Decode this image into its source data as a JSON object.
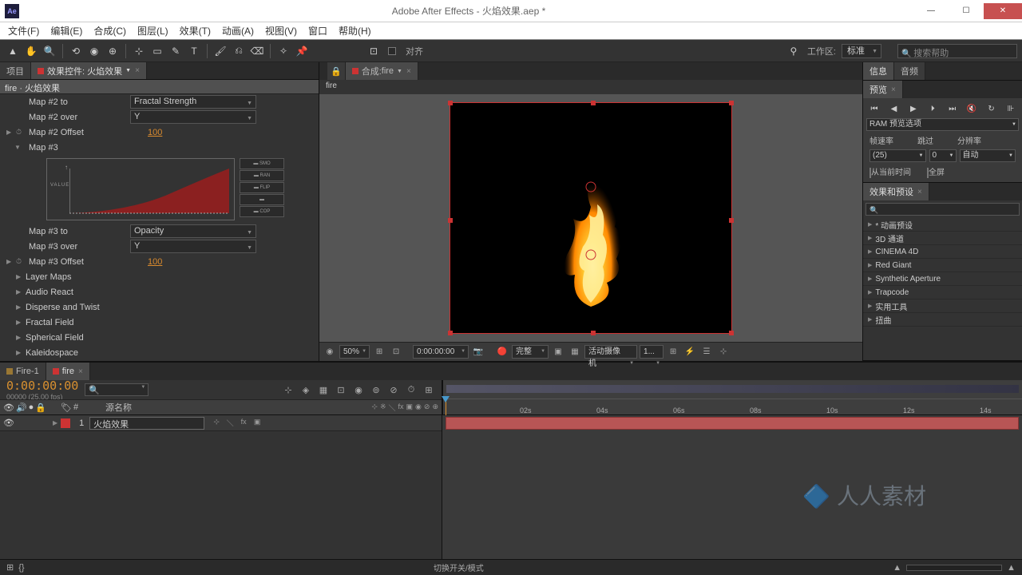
{
  "app": {
    "title": "Adobe After Effects - 火焰效果.aep *",
    "logo": "Ae"
  },
  "menu": [
    "文件(F)",
    "编辑(E)",
    "合成(C)",
    "图层(L)",
    "效果(T)",
    "动画(A)",
    "视图(V)",
    "窗口",
    "帮助(H)"
  ],
  "toolbar": {
    "align": "对齐",
    "workspace_lbl": "工作区:",
    "workspace": "标准",
    "search_ph": "搜索帮助"
  },
  "panels": {
    "project_tab": "项目",
    "effect_tab": "效果控件: 火焰效果",
    "effect_header": "fire · 火焰效果",
    "props": {
      "map2to": {
        "label": "Map #2 to",
        "val": "Fractal Strength"
      },
      "map2over": {
        "label": "Map #2 over",
        "val": "Y"
      },
      "map2off": {
        "label": "Map #2 Offset",
        "val": "100"
      },
      "map3": {
        "label": "Map #3"
      },
      "map3to": {
        "label": "Map #3 to",
        "val": "Opacity"
      },
      "map3over": {
        "label": "Map #3 over",
        "val": "Y"
      },
      "map3off": {
        "label": "Map #3 Offset",
        "val": "100"
      },
      "graphlabel": "VALUE",
      "groups": [
        "Layer Maps",
        "Audio React",
        "Disperse and Twist",
        "Fractal Field",
        "Spherical Field",
        "Kaleidospace"
      ]
    }
  },
  "comp": {
    "tab_prefix": "合成:",
    "name": "fire",
    "breadcrumb": "fire"
  },
  "viewer": {
    "zoom": "50%",
    "time": "0:00:00:00",
    "quality": "完整",
    "camera": "活动摄像机",
    "views": "1..."
  },
  "right": {
    "info_tab": "信息",
    "audio_tab": "音频",
    "preview_tab": "预览",
    "ram": "RAM 预览选项",
    "col1": "帧速率",
    "col2": "跳过",
    "col3": "分辨率",
    "fps": "(25)",
    "skip": "0",
    "res": "自动",
    "chk1": "从当前时间",
    "chk2": "全屏",
    "presets_tab": "效果和预设",
    "presets": [
      "* 动画预设",
      "3D 通道",
      "CINEMA 4D",
      "Red Giant",
      "Synthetic Aperture",
      "Trapcode",
      "实用工具",
      "扭曲"
    ]
  },
  "timeline": {
    "tab1": "Fire-1",
    "tab2": "fire",
    "timecode": "0:00:00:00",
    "fps": "00000 (25.00 fps)",
    "col_num": "#",
    "col_src": "源名称",
    "layer1_num": "1",
    "layer1_name": "火焰效果",
    "ticks": [
      "02s",
      "04s",
      "06s",
      "08s",
      "10s",
      "12s",
      "14s"
    ],
    "footer": "切换开关/模式"
  },
  "watermark": "人人素材"
}
